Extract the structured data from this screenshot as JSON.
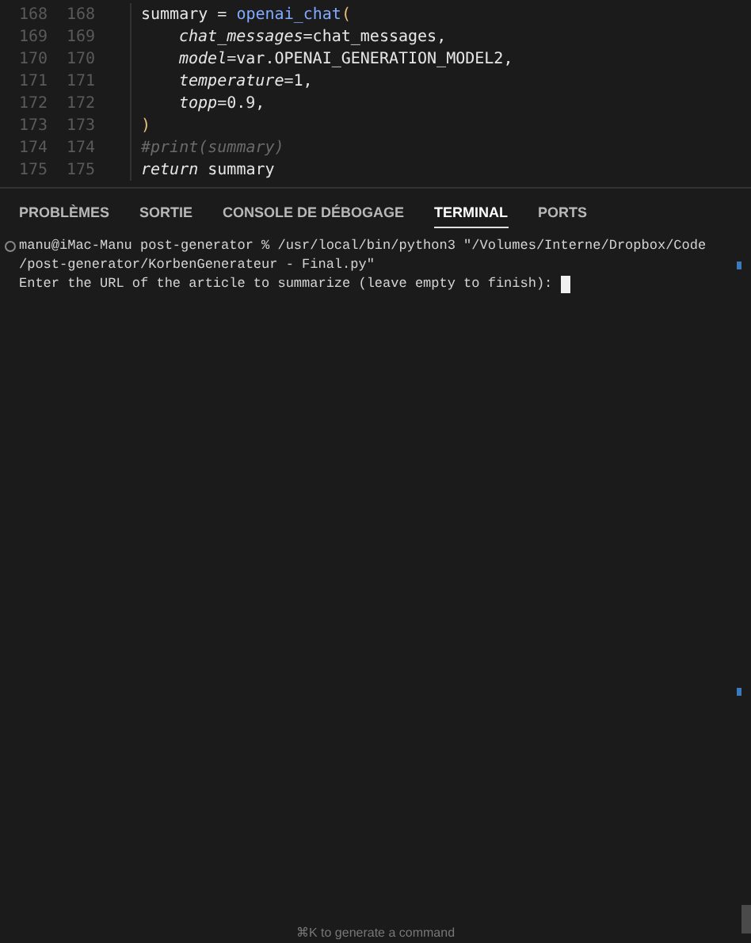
{
  "editor": {
    "lines": [
      {
        "old": "168",
        "new": "168",
        "indented": false,
        "tokens": [
          {
            "text": "summary = ",
            "kind": "plain"
          },
          {
            "text": "openai_chat",
            "kind": "func"
          },
          {
            "text": "(",
            "kind": "bracket"
          }
        ]
      },
      {
        "old": "169",
        "new": "169",
        "indented": true,
        "tokens": [
          {
            "text": "chat_messages",
            "kind": "param"
          },
          {
            "text": "=chat_messages,",
            "kind": "plain"
          }
        ]
      },
      {
        "old": "170",
        "new": "170",
        "indented": true,
        "tokens": [
          {
            "text": "model",
            "kind": "param"
          },
          {
            "text": "=var.OPENAI_GENERATION_MODEL2,",
            "kind": "plain"
          }
        ]
      },
      {
        "old": "171",
        "new": "171",
        "indented": true,
        "tokens": [
          {
            "text": "temperature",
            "kind": "param"
          },
          {
            "text": "=1,",
            "kind": "plain"
          }
        ]
      },
      {
        "old": "172",
        "new": "172",
        "indented": true,
        "tokens": [
          {
            "text": "topp",
            "kind": "param"
          },
          {
            "text": "=0.9,",
            "kind": "plain"
          }
        ]
      },
      {
        "old": "173",
        "new": "173",
        "indented": false,
        "tokens": [
          {
            "text": ")",
            "kind": "bracket"
          }
        ]
      },
      {
        "old": "174",
        "new": "174",
        "indented": false,
        "tokens": [
          {
            "text": "#print(summary)",
            "kind": "comment"
          }
        ]
      },
      {
        "old": "175",
        "new": "175",
        "indented": false,
        "tokens": [
          {
            "text": "return",
            "kind": "keyword"
          },
          {
            "text": " summary",
            "kind": "plain"
          }
        ]
      }
    ]
  },
  "panel": {
    "tabs": [
      {
        "label": "PROBLÈMES",
        "selected": false
      },
      {
        "label": "SORTIE",
        "selected": false
      },
      {
        "label": "CONSOLE DE DÉBOGAGE",
        "selected": false
      },
      {
        "label": "TERMINAL",
        "selected": true
      },
      {
        "label": "PORTS",
        "selected": false
      }
    ]
  },
  "terminal": {
    "lines": [
      "manu@iMac-Manu post-generator % /usr/local/bin/python3 \"/Volumes/Interne/Dropbox/Code",
      "/post-generator/KorbenGenerateur - Final.py\"",
      "Enter the URL of the article to summarize (leave empty to finish): "
    ],
    "hint": "⌘K to generate a command"
  }
}
